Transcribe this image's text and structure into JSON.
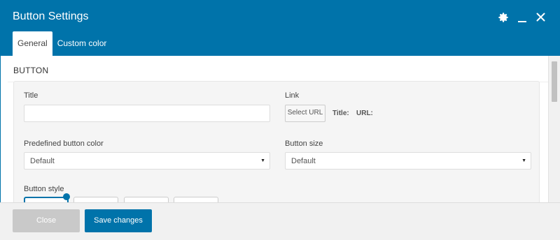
{
  "window": {
    "title": "Button Settings"
  },
  "header_icons": [
    "gear-icon",
    "minimize-icon",
    "close-icon"
  ],
  "tabs": [
    {
      "label": "General",
      "active": true
    },
    {
      "label": "Custom color",
      "active": false
    }
  ],
  "section": {
    "heading": "BUTTON"
  },
  "fields": {
    "title_label": "Title",
    "title_value": "",
    "link_label": "Link",
    "select_url_label": "Select URL",
    "link_title_label": "Title:",
    "link_url_label": "URL:",
    "predefined_color_label": "Predefined button color",
    "predefined_color_value": "Default",
    "button_size_label": "Button size",
    "button_size_value": "Default",
    "button_style_label": "Button style"
  },
  "footer": {
    "close_label": "Close",
    "save_label": "Save changes"
  },
  "colors": {
    "accent": "#0073aa",
    "panel_bg": "#f5f5f5",
    "disabled_button": "#c9c9c9"
  }
}
